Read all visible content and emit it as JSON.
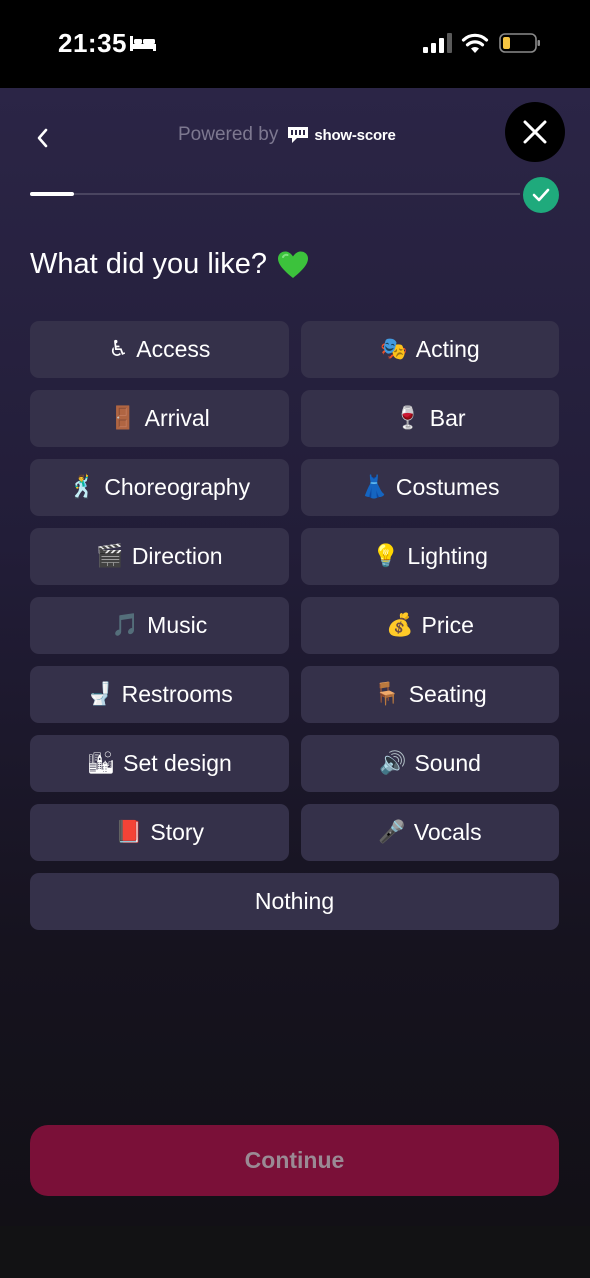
{
  "status_bar": {
    "time": "21:35",
    "icons": [
      "bed-icon",
      "cellular-signal-icon",
      "wifi-icon",
      "battery-icon"
    ]
  },
  "header": {
    "back_icon": "chevron-left-icon",
    "powered_by": "Powered by",
    "brand": "show-score",
    "close_icon": "close-icon"
  },
  "progress": {
    "fraction": 0.09,
    "complete_icon": "check-icon",
    "complete_color": "#1faa7c"
  },
  "question": {
    "text": "What did you like?",
    "emoji": "green-heart-icon"
  },
  "options": [
    {
      "emoji": "♿",
      "label": "Access"
    },
    {
      "emoji": "🎭",
      "label": "Acting"
    },
    {
      "emoji": "🚪",
      "label": "Arrival"
    },
    {
      "emoji": "🍷",
      "label": "Bar"
    },
    {
      "emoji": "🕺",
      "label": "Choreography"
    },
    {
      "emoji": "👗",
      "label": "Costumes"
    },
    {
      "emoji": "🎬",
      "label": "Direction"
    },
    {
      "emoji": "💡",
      "label": "Lighting"
    },
    {
      "emoji": "🎵",
      "label": "Music"
    },
    {
      "emoji": "💰",
      "label": "Price"
    },
    {
      "emoji": "🚽",
      "label": "Restrooms"
    },
    {
      "emoji": "🪑",
      "label": "Seating"
    },
    {
      "emoji": "🏙",
      "label": "Set design"
    },
    {
      "emoji": "🔊",
      "label": "Sound"
    },
    {
      "emoji": "📕",
      "label": "Story"
    },
    {
      "emoji": "🎤",
      "label": "Vocals"
    }
  ],
  "nothing_option": {
    "label": "Nothing"
  },
  "continue_button": {
    "label": "Continue",
    "color": "#7a1038"
  },
  "colors": {
    "option_bg": "#35314a",
    "background_top": "#2b2546",
    "accent_green": "#1faa7c"
  }
}
